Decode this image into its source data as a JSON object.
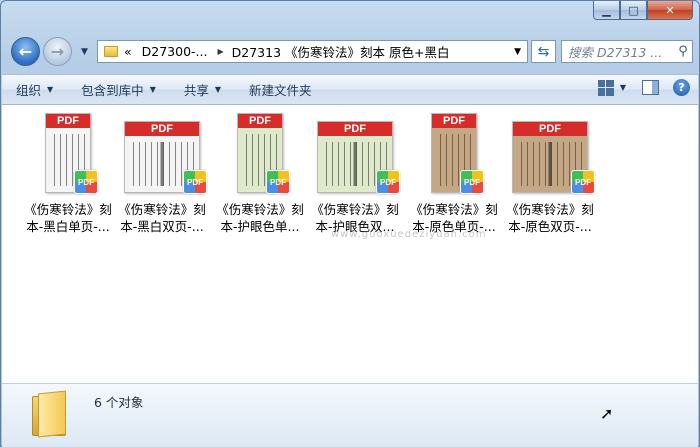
{
  "window": {
    "caption": {
      "minimize": "▁",
      "maximize": "□",
      "close": "✕"
    }
  },
  "nav": {
    "back_icon": "arrow-left-icon",
    "forward_icon": "arrow-right-icon",
    "address": {
      "overflow": "«",
      "segments": [
        "D27300-...",
        "D27313 《伤寒铃法》刻本 原色+黑白"
      ]
    },
    "search_placeholder": "搜索 D27313 ..."
  },
  "commands": [
    {
      "label": "组织",
      "dropdown": true
    },
    {
      "label": "包含到库中",
      "dropdown": true
    },
    {
      "label": "共享",
      "dropdown": true
    },
    {
      "label": "新建文件夹",
      "dropdown": false
    }
  ],
  "files": [
    {
      "line1": "《伤寒铃法》刻",
      "line2": "本-黑白单页-...",
      "layout": "single",
      "tone": "bw",
      "pdf": "PDF"
    },
    {
      "line1": "《伤寒铃法》刻",
      "line2": "本-黑白双页-...",
      "layout": "double",
      "tone": "bw",
      "pdf": "PDF"
    },
    {
      "line1": "《伤寒铃法》刻",
      "line2": "本-护眼色单...",
      "layout": "single",
      "tone": "green",
      "pdf": "PDF"
    },
    {
      "line1": "《伤寒铃法》刻",
      "line2": "本-护眼色双...",
      "layout": "double",
      "tone": "green",
      "pdf": "PDF"
    },
    {
      "line1": "《伤寒铃法》刻",
      "line2": "本-原色单页-...",
      "layout": "single",
      "tone": "orig",
      "pdf": "PDF"
    },
    {
      "line1": "《伤寒铃法》刻",
      "line2": "本-原色双页-...",
      "layout": "double",
      "tone": "orig",
      "pdf": "PDF"
    }
  ],
  "watermark": "www.guoxuedeziyuan.com",
  "status": {
    "count_text": "6 个对象"
  },
  "colors": {
    "pdf_red": "#d72d2a",
    "bw": "#f4f4f4",
    "green": "#dfe9cc",
    "orig": "#c4a785"
  }
}
